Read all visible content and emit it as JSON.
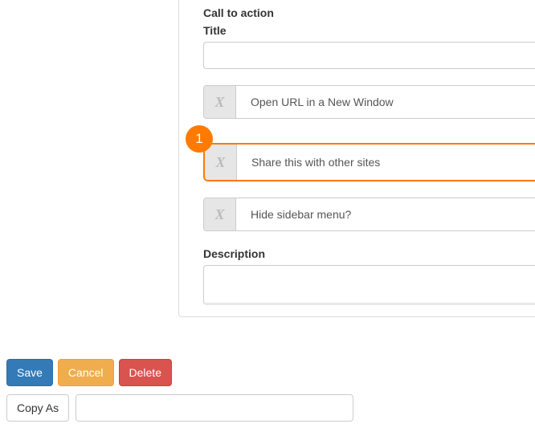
{
  "panel": {
    "section_label": "Call to action",
    "title_label": "Title",
    "title_value": "",
    "options": {
      "open_url": {
        "checkmark": "X",
        "label": "Open URL in a New Window"
      },
      "share": {
        "checkmark": "X",
        "label": "Share this with other sites"
      },
      "hide_sidebar": {
        "checkmark": "X",
        "label": "Hide sidebar menu?"
      }
    },
    "description_label": "Description",
    "description_value": ""
  },
  "annotation": {
    "marker_1": "1"
  },
  "footer": {
    "save": "Save",
    "cancel": "Cancel",
    "delete": "Delete",
    "copy_as": "Copy As",
    "copy_as_value": ""
  }
}
